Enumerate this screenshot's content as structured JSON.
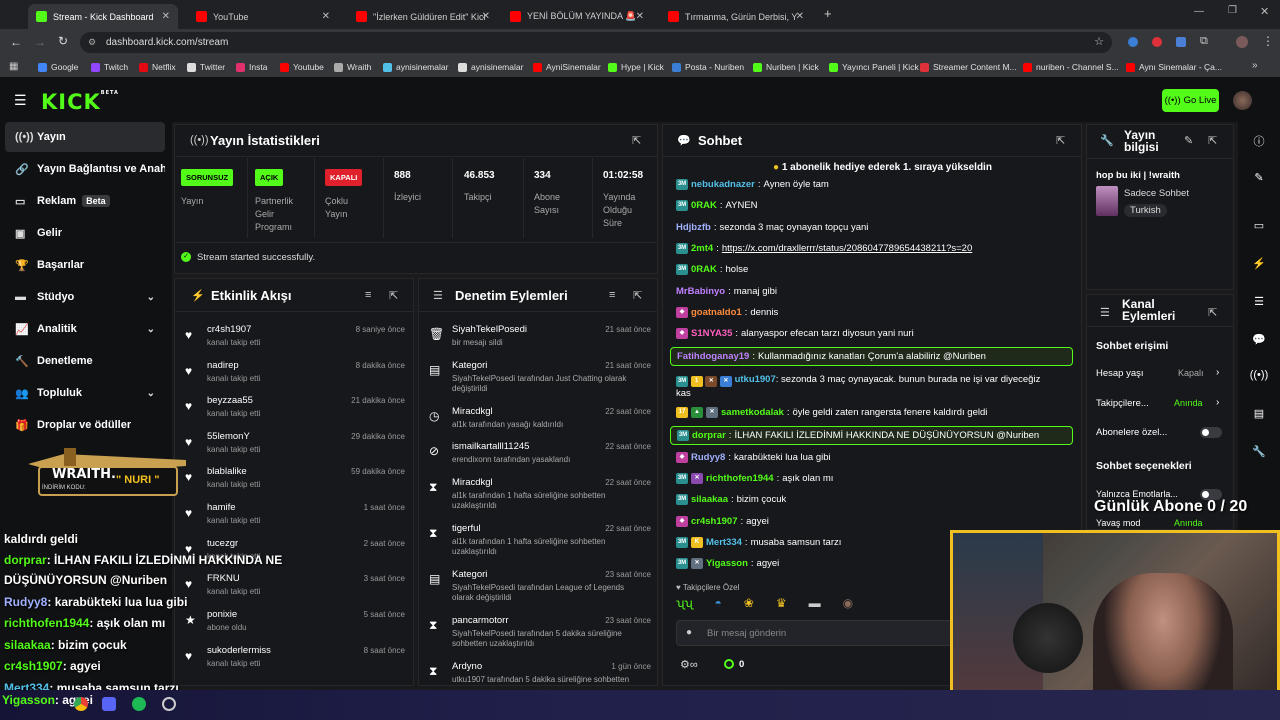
{
  "browser": {
    "tabs": [
      {
        "title": "Stream - Kick Dashboard",
        "color": "#53fc18"
      },
      {
        "title": "YouTube",
        "color": "#ff0000"
      },
      {
        "title": "\"İzlerken Güldüren Edit\" Kick &",
        "color": "#ff0000"
      },
      {
        "title": "YENİ BÖLÜM YAYINDA 🚨 @O",
        "color": "#ff0000"
      },
      {
        "title": "Tırmanma, Gürün Derbisi, Yüks",
        "color": "#ff0000"
      }
    ],
    "url": "dashboard.kick.com/stream",
    "bookmarks": [
      "Google",
      "Twitch",
      "Netflix",
      "Twitter",
      "Insta",
      "Youtube",
      "Wraith",
      "aynisinemalar",
      "aynisinemalar",
      "AyniSinemalar",
      "Hype | Kick",
      "Posta - Nuriben",
      "Nuriben | Kick",
      "Yayıncı Paneli | Kick",
      "Streamer Content M...",
      "nuriben - Channel S...",
      "Aynı Sinemalar - Ça..."
    ]
  },
  "header": {
    "logo": "KICK",
    "logo_sup": "BETA",
    "go_live": "Go Live"
  },
  "sidebar": {
    "items": [
      {
        "label": "Yayın",
        "icon": "broadcast-icon"
      },
      {
        "label": "Yayın Bağlantısı ve Anahtarı",
        "icon": "link-icon"
      },
      {
        "label": "Reklam",
        "icon": "ad-icon",
        "badge": "Beta"
      },
      {
        "label": "Gelir",
        "icon": "money-icon"
      },
      {
        "label": "Başarılar",
        "icon": "trophy-icon"
      },
      {
        "label": "Stüdyo",
        "icon": "studio-icon"
      },
      {
        "label": "Analitik",
        "icon": "chart-icon"
      },
      {
        "label": "Denetleme",
        "icon": "hammer-icon"
      },
      {
        "label": "Topluluk",
        "icon": "community-icon"
      },
      {
        "label": "Droplar ve ödüller",
        "icon": "gift-icon"
      }
    ]
  },
  "stats": {
    "title": "Yayın İstatistikleri",
    "sorunsuz": "SORUNSUZ",
    "sorunsuz_lbl": "Yayın",
    "acik": "AÇIK",
    "acik_lbl": "Partnerlik Gelir Programı",
    "kapali": "KAPALI",
    "kapali_lbl": "Çoklu Yayın",
    "viewers": "888",
    "viewers_lbl": "İzleyici",
    "followers": "46.853",
    "followers_lbl": "Takipçi",
    "subs": "334",
    "subs_lbl": "Abone Sayısı",
    "uptime": "01:02:58",
    "uptime_lbl": "Yayında Olduğu Süre",
    "success": "Stream started successfully."
  },
  "activity": {
    "title": "Etkinlik Akışı",
    "items": [
      {
        "name": "cr4sh1907",
        "sub": "kanalı takip etti",
        "time": "8 saniye önce"
      },
      {
        "name": "nadirep",
        "sub": "kanalı takip etti",
        "time": "8 dakika önce"
      },
      {
        "name": "beyzzaa55",
        "sub": "kanalı takip etti",
        "time": "21 dakika önce"
      },
      {
        "name": "55lemonY",
        "sub": "kanalı takip etti",
        "time": "29 dakika önce"
      },
      {
        "name": "blablalike",
        "sub": "kanalı takip etti",
        "time": "59 dakika önce"
      },
      {
        "name": "hamife",
        "sub": "kanalı takip etti",
        "time": "1 saat önce"
      },
      {
        "name": "tucezgr",
        "sub": "kanalı takip etti",
        "time": "2 saat önce"
      },
      {
        "name": "FRKNU",
        "sub": "kanalı takip etti",
        "time": "3 saat önce"
      },
      {
        "name": "ponixie",
        "sub": "abone oldu",
        "time": "5 saat önce"
      },
      {
        "name": "sukoderlermiss",
        "sub": "kanalı takip etti",
        "time": "8 saat önce"
      }
    ]
  },
  "moderation": {
    "title": "Denetim Eylemleri",
    "items": [
      {
        "name": "SiyahTekelPosedi",
        "desc": "bir mesajı sildi",
        "time": "21 saat önce",
        "icon": "trash-icon"
      },
      {
        "name": "Kategori",
        "desc": "SiyahTekelPosedi tarafından Just Chatting olarak değiştirildi",
        "time": "21 saat önce",
        "icon": "category-icon"
      },
      {
        "name": "Miracdkgl",
        "desc": "al1k tarafından yasağı kaldırıldı",
        "time": "22 saat önce",
        "icon": "clock-icon"
      },
      {
        "name": "ismailkartalll11245",
        "desc": "erendixonn tarafından yasaklandı",
        "time": "22 saat önce",
        "icon": "ban-icon"
      },
      {
        "name": "Miracdkgl",
        "desc": "al1k tarafından 1 hafta süreliğine sohbetten uzaklaştırıldı",
        "time": "22 saat önce",
        "icon": "hourglass-icon"
      },
      {
        "name": "tigerful",
        "desc": "al1k tarafından 1 hafta süreliğine sohbetten uzaklaştırıldı",
        "time": "22 saat önce",
        "icon": "hourglass-icon"
      },
      {
        "name": "Kategori",
        "desc": "SiyahTekelPosedi tarafından League of Legends olarak değiştirildi",
        "time": "23 saat önce",
        "icon": "category-icon"
      },
      {
        "name": "pancarmotorr",
        "desc": "SiyahTekelPosedi tarafından 5 dakika süreliğine sohbetten uzaklaştırıldı",
        "time": "23 saat önce",
        "icon": "hourglass-icon"
      },
      {
        "name": "Ardyno",
        "desc": "utku1907 tarafından 5 dakika süreliğine sohbetten",
        "time": "1 gün önce",
        "icon": "hourglass-icon"
      }
    ]
  },
  "chat": {
    "title": "Sohbet",
    "pinned": "1 abonelik hediye ederek 1. sıraya yükseldin",
    "messages": [
      {
        "user": "nebukadnazer",
        "color": "#53c0e8",
        "text": "Aynen öyle tam",
        "hl": false
      },
      {
        "user": "0RAK",
        "color": "#53fc18",
        "text": "AYNEN",
        "hl": false
      },
      {
        "user": "Hdjbzfb",
        "color": "#a0b0ff",
        "text": "sezonda 3 maç oynayan topçu yani",
        "hl": false
      },
      {
        "user": "2mt4",
        "color": "#53fc18",
        "text": "https://x.com/draxllerrr/status/2086047789654438211?s=20",
        "hl": false
      },
      {
        "user": "0RAK",
        "color": "#53fc18",
        "text": "holse",
        "hl": false
      },
      {
        "user": "MrBabinyo",
        "color": "#c080ff",
        "text": "manaj gibi",
        "hl": false
      },
      {
        "user": "goatnaldo1",
        "color": "#ff8c3a",
        "text": "dennis",
        "hl": false
      },
      {
        "user": "S1NYA35",
        "color": "#ff60c0",
        "text": "alanyaspor efecan tarzı diyosun yani nuri",
        "hl": false
      },
      {
        "user": "Fatihdoganay19",
        "color": "#c080ff",
        "text": "Kullanmadığınız kanatları Çorum'a alabiliriz @Nuriben",
        "hl": true
      },
      {
        "user": "utku1907",
        "color": "#53c0e8",
        "text": "sezonda 3 maç oynayacak. bunun burada ne işi var diyeceğiz kas",
        "hl": false
      },
      {
        "user": "sametkodalak",
        "color": "#53fc18",
        "text": "öyle geldi zaten rangersta fenere kaldırdı geldi",
        "hl": false
      },
      {
        "user": "dorprar",
        "color": "#53fc18",
        "text": "İLHAN FAKILI İZLEDİNMİ HAKKINDA NE DÜŞÜNÜYORSUN @Nuriben",
        "hl": true
      },
      {
        "user": "Rudyy8",
        "color": "#a0b0ff",
        "text": "karabükteki lua lua gibi",
        "hl": false
      },
      {
        "user": "richthofen1944",
        "color": "#53fc18",
        "text": "aşık olan mı",
        "hl": false
      },
      {
        "user": "silaakaa",
        "color": "#53fc18",
        "text": "bizim çocuk",
        "hl": false
      },
      {
        "user": "cr4sh1907",
        "color": "#53fc18",
        "text": "agyei",
        "hl": false
      },
      {
        "user": "Mert334",
        "color": "#53c0e8",
        "text": "musaba samsun tarzı",
        "hl": false
      },
      {
        "user": "Yigasson",
        "color": "#53fc18",
        "text": "agyei",
        "hl": false
      }
    ],
    "followers_only": "Takipçilere Özel",
    "input_placeholder": "Bir mesaj gönderin",
    "points": "0"
  },
  "stream_info": {
    "title": "Yayın bilgisi",
    "stream_title": "hop bu iki | !wraith",
    "category": "Sadece Sohbet",
    "tag": "Turkish"
  },
  "channel_actions": {
    "title": "Kanal Eylemleri",
    "section1": "Sohbet erişimi",
    "age_label": "Hesap yaşı",
    "age_value": "Kapalı",
    "followers_label": "Takipçilere...",
    "followers_value": "Anında",
    "subs_label": "Abonelere özel...",
    "section2": "Sohbet seçenekleri",
    "emotes_label": "Yalnızca Emotlarla...",
    "slow_label": "Yavaş mod",
    "slow_value": "Anında"
  },
  "overlay": {
    "brand": "WRAITH.",
    "code_label": "İNDİRİM KODU:",
    "code": "\" NURI \"",
    "goal": "Günlük Abone 0 / 20",
    "lines": [
      {
        "user": "",
        "text": "kaldırdı geldi",
        "color": "#ffffff"
      },
      {
        "user": "dorprar",
        "text": ": İLHAN FAKILI İZLEDİNMİ HAKKINDA NE",
        "color": "#53fc18"
      },
      {
        "user": "",
        "text": "DÜŞÜNÜYORSUN @Nuriben",
        "color": "#ffffff"
      },
      {
        "user": "Rudyy8",
        "text": ": karabükteki lua lua gibi",
        "color": "#a0b0ff"
      },
      {
        "user": "richthofen1944",
        "text": ": aşık olan mı",
        "color": "#53fc18"
      },
      {
        "user": "silaakaa",
        "text": ": bizim çocuk",
        "color": "#53fc18"
      },
      {
        "user": "cr4sh1907",
        "text": ": agyei",
        "color": "#53fc18"
      },
      {
        "user": "Mert334",
        "text": ": musaba samsun tarzı",
        "color": "#53c0e8"
      },
      {
        "user": "Yigasson",
        "text": ": agyei",
        "color": "#53fc18"
      }
    ]
  }
}
